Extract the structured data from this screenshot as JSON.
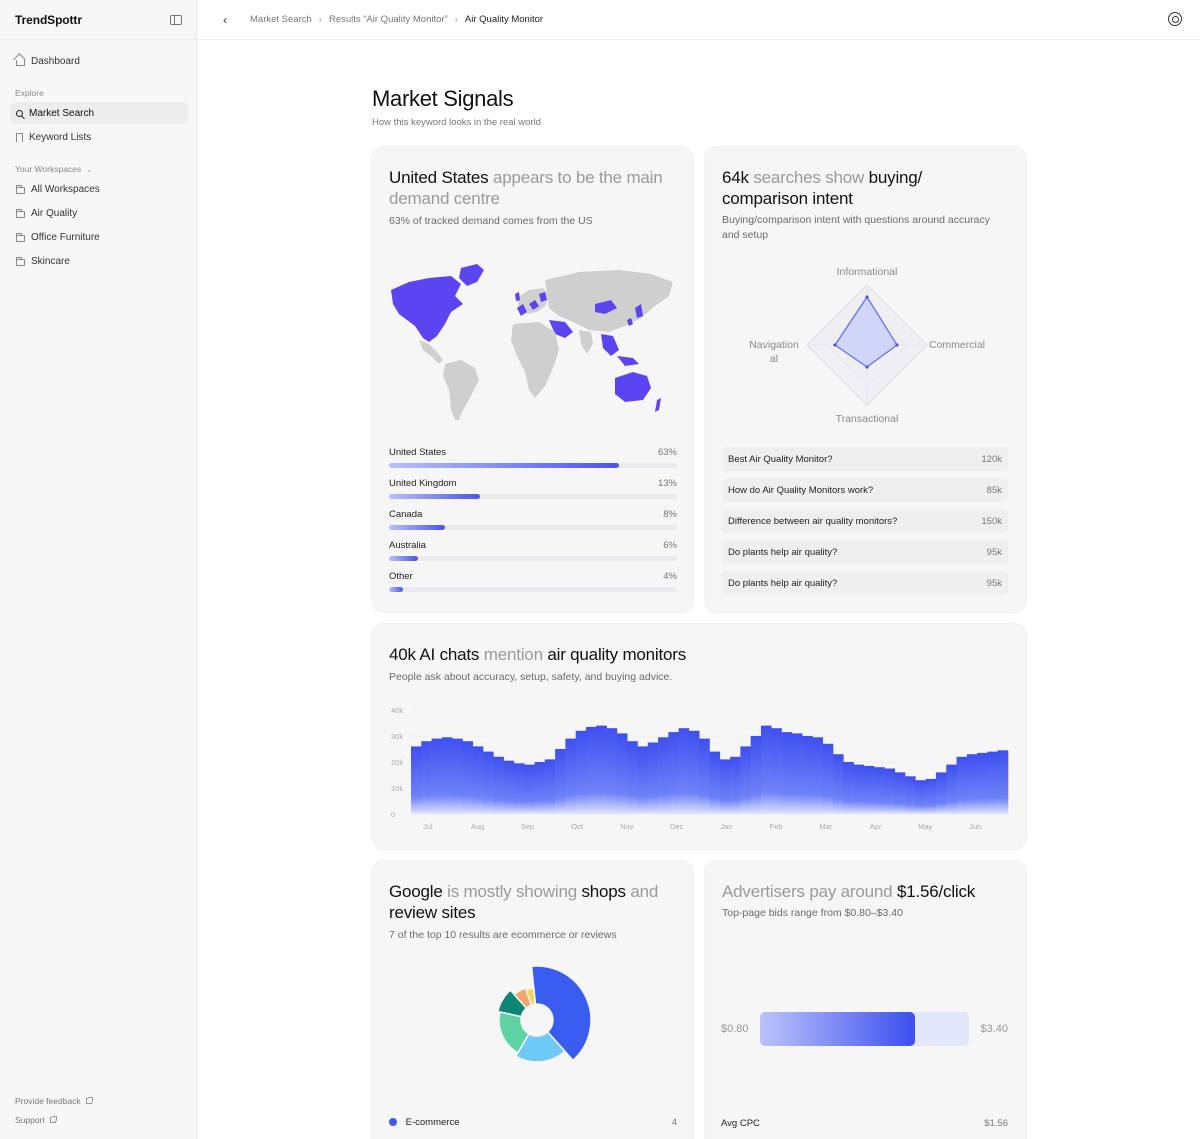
{
  "app": {
    "name": "TrendSpottr"
  },
  "sidebar": {
    "dashboard": "Dashboard",
    "explore_label": "Explore",
    "market_search": "Market Search",
    "keyword_lists": "Keyword Lists",
    "workspaces_label": "Your Workspaces",
    "workspaces": [
      "All Workspaces",
      "Air Quality",
      "Office Furniture",
      "Skincare"
    ],
    "feedback": "Provide feedback",
    "support": "Support"
  },
  "topbar": {
    "crumbs": [
      "Market Search",
      "Results “Air Quality Monitor”",
      "Air Quality Monitor"
    ]
  },
  "page": {
    "title": "Market Signals",
    "subtitle": "How this keyword looks in the real world"
  },
  "demand": {
    "title_strong": "United States",
    "title_muted": " appears to be the main demand centre",
    "subtitle": "63% of tracked demand comes from the US",
    "countries": [
      {
        "name": "United States",
        "value": "63%",
        "pct": 0.8
      },
      {
        "name": "United Kingdom",
        "value": "13%",
        "pct": 0.315
      },
      {
        "name": "Canada",
        "value": "8%",
        "pct": 0.195
      },
      {
        "name": "Australia",
        "value": "6%",
        "pct": 0.1
      },
      {
        "name": "Other",
        "value": "4%",
        "pct": 0.05
      }
    ]
  },
  "intent": {
    "title_strong": "64k",
    "title_muted": " searches show ",
    "title_strong2": "buying/ comparison intent",
    "subtitle": "Buying/comparison intent with questions around accuracy and setup",
    "axes": {
      "top": "Informational",
      "right": "Commercial",
      "bottom": "Transactional",
      "left": "Navigational"
    },
    "questions": [
      {
        "q": "Best Air Quality Monitor?",
        "v": "120k"
      },
      {
        "q": "How do Air Quality Monitors work?",
        "v": "85k"
      },
      {
        "q": "Difference between air quality monitors?",
        "v": "150k"
      },
      {
        "q": "Do plants help air quality?",
        "v": "95k"
      },
      {
        "q": "Do plants help air quality?",
        "v": "95k"
      }
    ]
  },
  "ai_chats": {
    "title_strong": "40k AI chats",
    "title_muted": " mention ",
    "title_strong2": "air quality monitors",
    "subtitle": "People ask about accuracy, setup, safety, and buying advice."
  },
  "chart_data": {
    "type": "bar",
    "categories": [
      "Jul",
      "Aug",
      "Sep",
      "Oct",
      "Nov",
      "Dec",
      "Jan",
      "Feb",
      "Mar",
      "Apr",
      "May",
      "Jun"
    ],
    "ytick_labels": [
      "40k",
      "30k",
      "20k",
      "10k",
      "0"
    ],
    "ylim": [
      0,
      40000
    ],
    "values": [
      26000,
      28000,
      29000,
      29500,
      29000,
      28000,
      26000,
      24000,
      22000,
      20500,
      19500,
      19000,
      20000,
      21000,
      25000,
      29000,
      32000,
      33500,
      34000,
      33000,
      31000,
      28000,
      26000,
      27500,
      29500,
      31500,
      33000,
      32000,
      29000,
      24000,
      21000,
      22000,
      26000,
      30000,
      34000,
      33000,
      31500,
      31000,
      30000,
      29500,
      27000,
      23000,
      20000,
      19000,
      18500,
      18000,
      17500,
      16000,
      14500,
      13000,
      13500,
      16000,
      19000,
      22000,
      23000,
      23500,
      24000,
      24500
    ]
  },
  "serp": {
    "title_strong": "Google",
    "title_muted": " is mostly showing ",
    "title_strong2": "shops",
    "title_muted2": " and ",
    "title_strong3": "review sites",
    "subtitle": "7 of the top 10 results are ecommerce or reviews",
    "legend": [
      {
        "name": "E-commerce",
        "value": "4"
      }
    ],
    "slices": [
      {
        "name": "E-commerce",
        "value": 4,
        "color": "#3b5cf0"
      },
      {
        "name": "blue-light",
        "value": 2,
        "color": "#6ec9f6"
      },
      {
        "name": "green",
        "value": 2,
        "color": "#5fd3a6"
      },
      {
        "name": "teal",
        "value": 1,
        "color": "#0f8578"
      },
      {
        "name": "orange",
        "value": 0.6,
        "color": "#f0a86a"
      },
      {
        "name": "yellow",
        "value": 0.4,
        "color": "#f4d35e"
      }
    ]
  },
  "cpc": {
    "title_muted": "Advertisers pay around ",
    "title_strong": "$1.56/click",
    "subtitle": "Top-page bids range from $0.80–$3.40",
    "min": "$0.80",
    "max": "$3.40",
    "avg_label": "Avg CPC",
    "avg_value": "$1.56"
  }
}
